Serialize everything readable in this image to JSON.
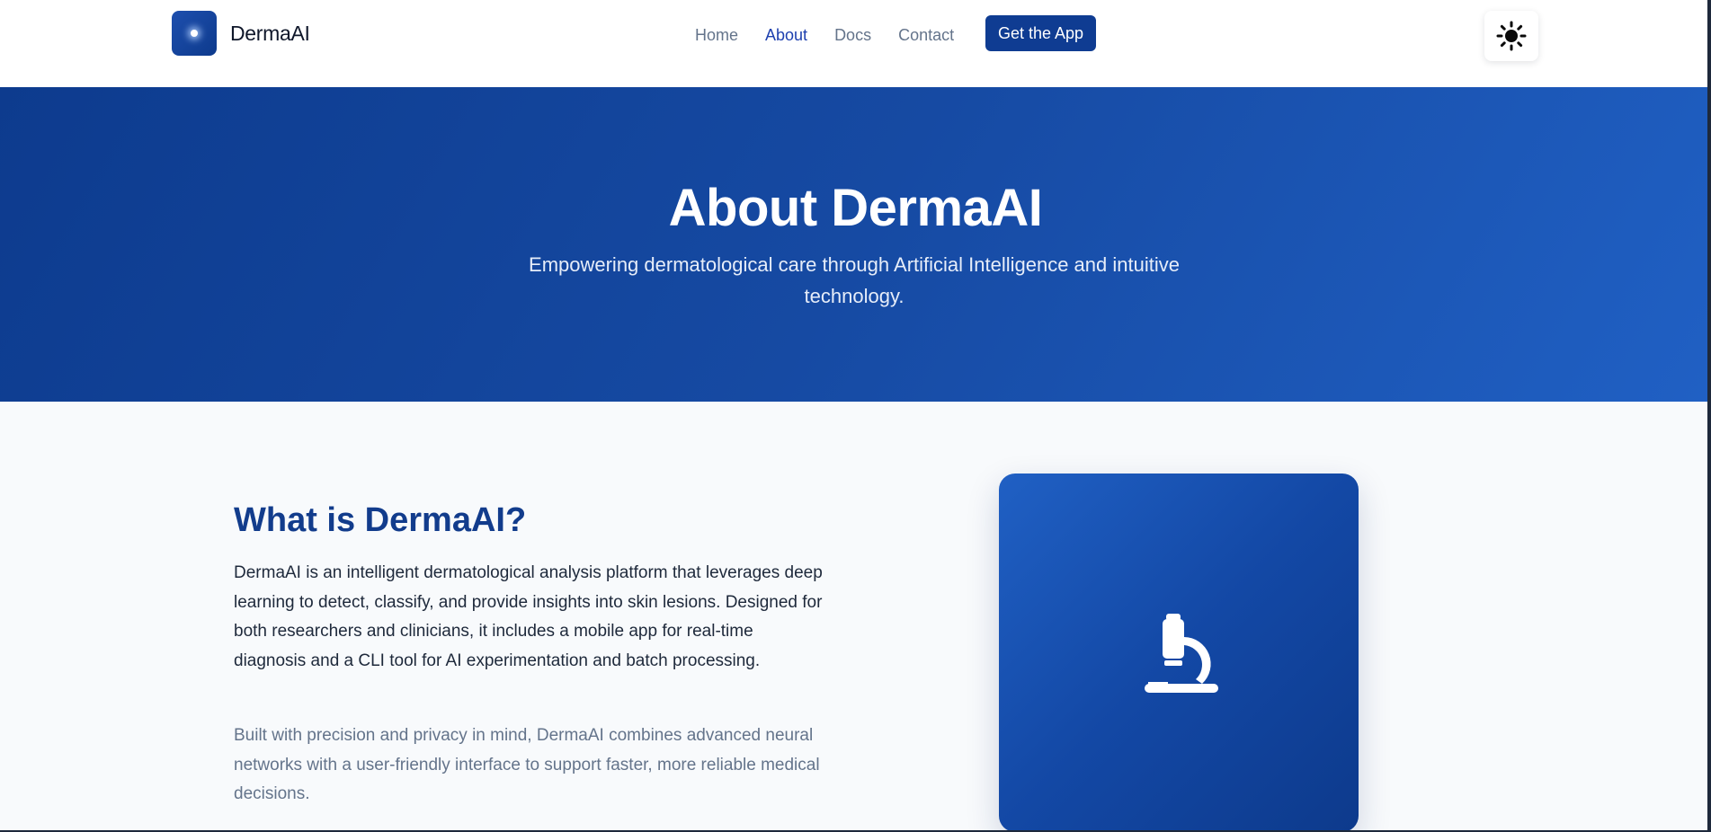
{
  "header": {
    "brand": "DermaAI",
    "nav": [
      {
        "label": "Home",
        "active": false
      },
      {
        "label": "About",
        "active": true
      },
      {
        "label": "Docs",
        "active": false
      },
      {
        "label": "Contact",
        "active": false
      }
    ],
    "cta_label": "Get the App",
    "theme_icon": "sun-icon"
  },
  "hero": {
    "title": "About DermaAI",
    "subtitle": "Empowering dermatological care through Artificial Intelligence and intuitive technology."
  },
  "main": {
    "heading": "What is DermaAI?",
    "paragraph1": "DermaAI is an intelligent dermatological analysis platform that leverages deep learning to detect, classify, and provide insights into skin lesions. Designed for both researchers and clinicians, it includes a mobile app for real-time diagnosis and a CLI tool for AI experimentation and batch processing.",
    "paragraph2": "Built with precision and privacy in mind, DermaAI combines advanced neural networks with a user-friendly interface to support faster, more reliable medical decisions.",
    "card_icon": "microscope-icon"
  },
  "colors": {
    "brand_primary": "#0f3c92",
    "heading_blue": "#123c8c",
    "nav_active": "#1e40af",
    "nav_default": "#64748b"
  }
}
